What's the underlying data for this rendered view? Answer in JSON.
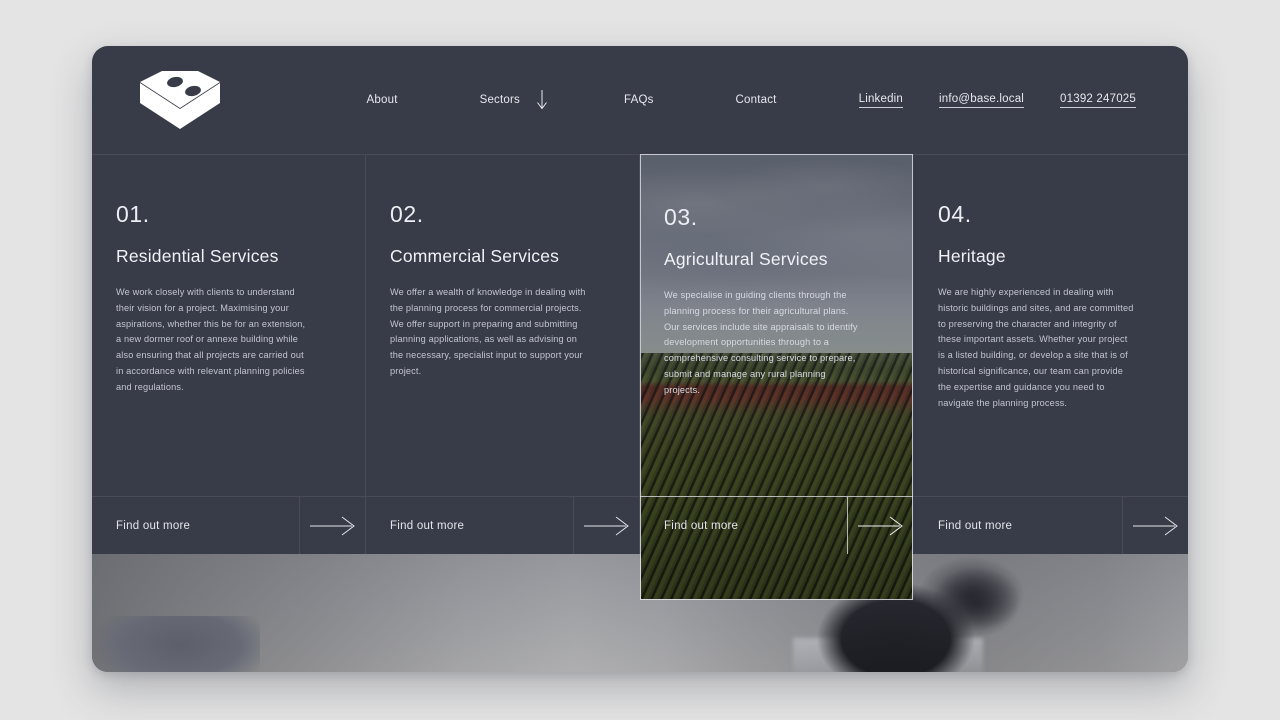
{
  "header": {
    "logo_name": "base-logo",
    "nav": [
      {
        "label": "About",
        "icon": null
      },
      {
        "label": "Sectors",
        "icon": "arrow-down-icon"
      },
      {
        "label": "FAQs",
        "icon": null
      },
      {
        "label": "Contact",
        "icon": null
      }
    ],
    "contacts": [
      {
        "label": "Linkedin"
      },
      {
        "label": "info@base.local"
      },
      {
        "label": "01392 247025"
      }
    ]
  },
  "cards": [
    {
      "number": "01.",
      "title": "Residential Services",
      "description": "We work closely with clients to understand their vision for a project. Maximising your aspirations, whether this be for an extension, a new dormer roof or annexe building while also ensuring that all projects are carried out in accordance with relevant planning policies and regulations.",
      "cta": "Find out more",
      "featured": false
    },
    {
      "number": "02.",
      "title": "Commercial Services",
      "description": "We offer a wealth of knowledge in dealing with the planning process for commercial projects. We offer support in preparing and submitting planning applications, as well as advising on the necessary, specialist input to support your project.",
      "cta": "Find out more",
      "featured": false
    },
    {
      "number": "03.",
      "title": "Agricultural Services",
      "description": "We specialise in guiding clients through the planning process for their agricultural plans. Our services include site appraisals to identify development opportunities through to a comprehensive consulting service to prepare, submit and manage any rural planning projects.",
      "cta": "Find out more",
      "featured": true
    },
    {
      "number": "04.",
      "title": "Heritage",
      "description": "We are highly experienced in dealing with historic buildings and sites, and are committed to preserving the character and integrity of these important assets. Whether your project is a listed building, or develop a site that is of historical significance, our team can provide the expertise and guidance you need to navigate the planning process.",
      "cta": "Find out more",
      "featured": false
    }
  ],
  "hero": {
    "alt": "grayscale photo of a person with dark hair seated in an interior"
  },
  "colors": {
    "page_background": "#e4e4e4",
    "panel_background": "#383b48",
    "text_primary": "#f1f2f6",
    "text_secondary": "#c3c6d2",
    "divider": "rgba(255,255,255,0.09)",
    "featured_border": "rgba(236,238,244,0.78)"
  }
}
